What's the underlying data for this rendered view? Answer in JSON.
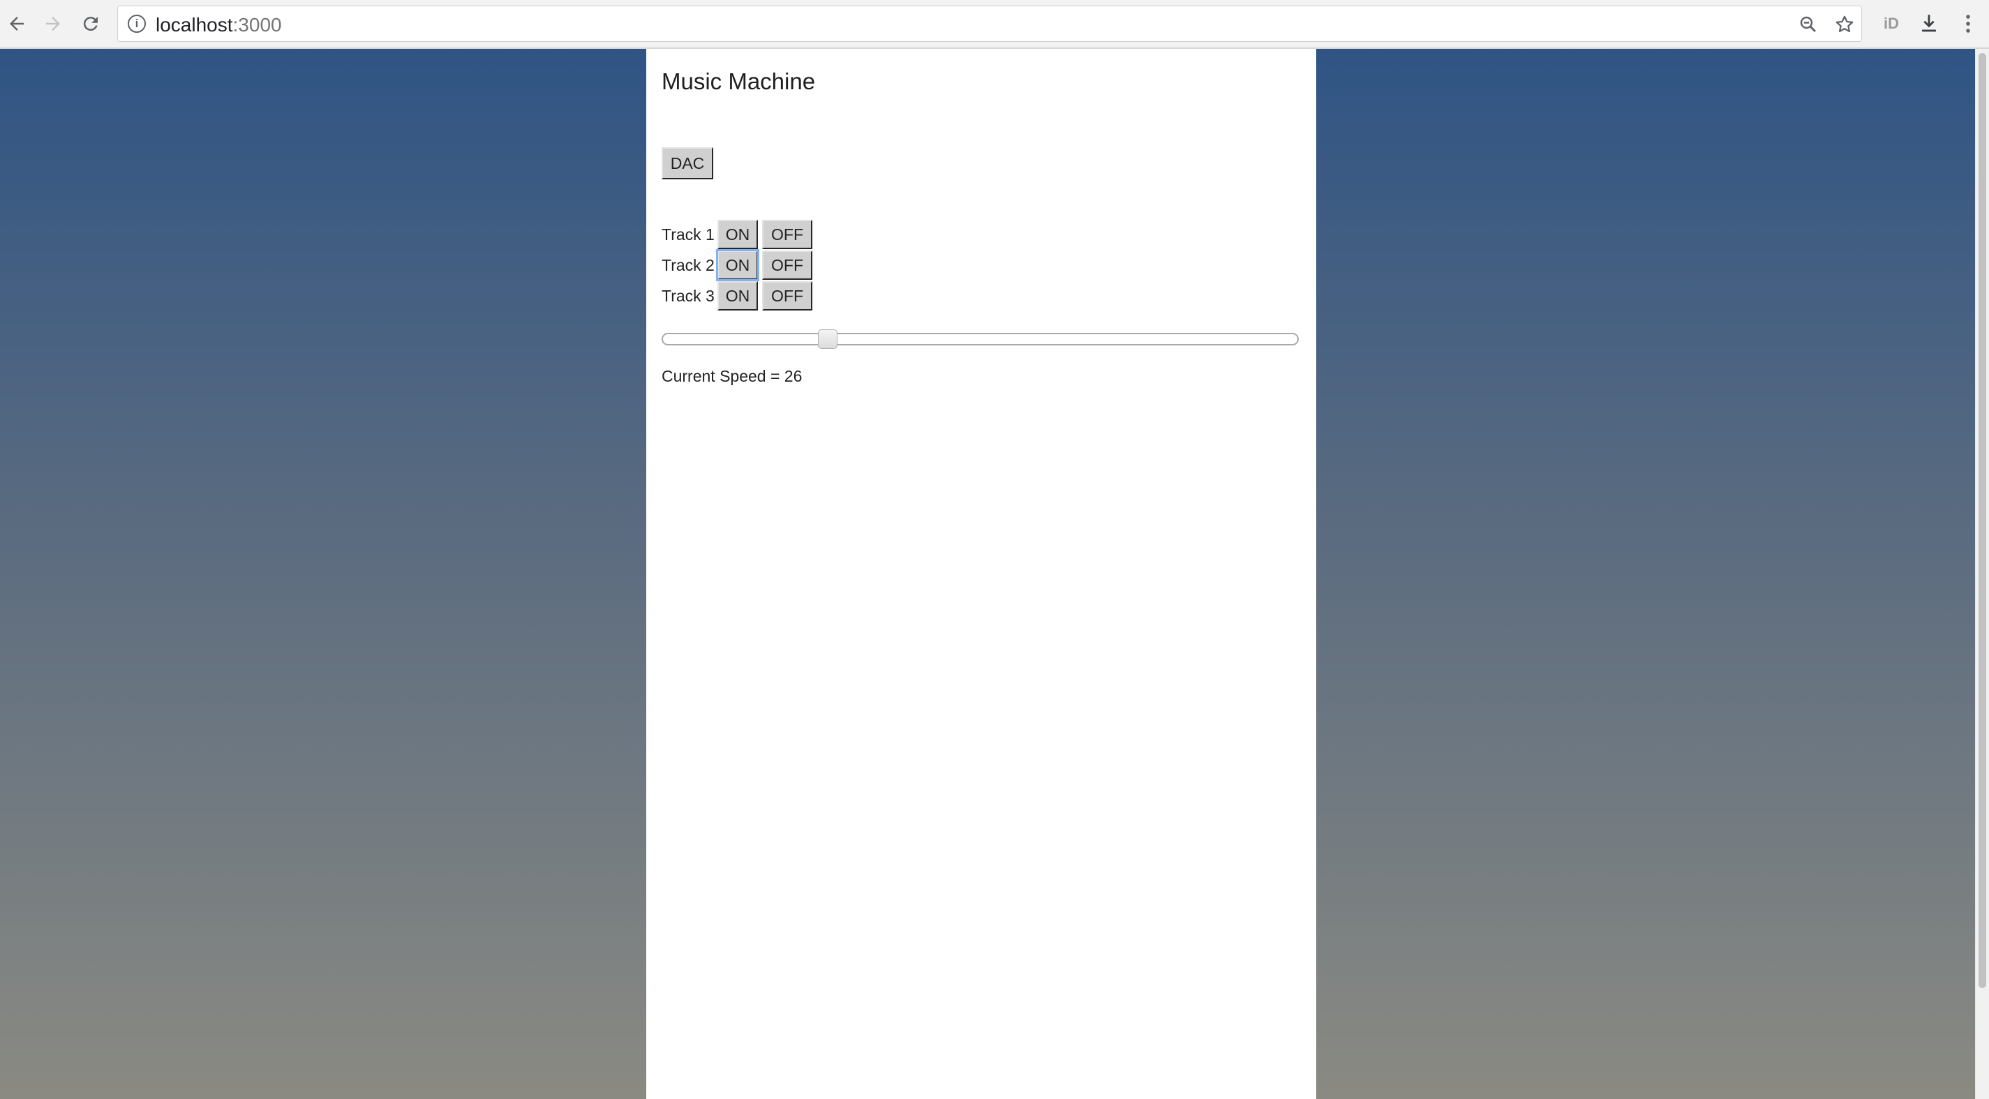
{
  "browser": {
    "url_host": "localhost",
    "url_port": ":3000",
    "icons": {
      "back": "back-arrow-icon",
      "forward": "forward-arrow-icon",
      "reload": "reload-icon",
      "info": "info-icon",
      "zoom": "zoom-icon",
      "star": "bookmark-star-icon",
      "extension": "extension-icon",
      "download": "download-icon",
      "menu": "kebab-menu-icon"
    },
    "extension_label": "iD"
  },
  "page": {
    "title": "Music Machine",
    "dac_label": "DAC",
    "tracks": [
      {
        "label": "Track 1",
        "on_label": "ON",
        "off_label": "OFF"
      },
      {
        "label": "Track 2",
        "on_label": "ON",
        "off_label": "OFF",
        "focused": "on"
      },
      {
        "label": "Track 3",
        "on_label": "ON",
        "off_label": "OFF"
      }
    ],
    "speed": {
      "slider_fraction": 0.26,
      "text": "Current Speed = 26"
    }
  },
  "colors": {
    "bg_top": "#2f5484",
    "bg_bottom": "#8a8a82",
    "panel": "#ffffff",
    "button": "#d0d0d0",
    "focus": "#7fb3f5"
  }
}
